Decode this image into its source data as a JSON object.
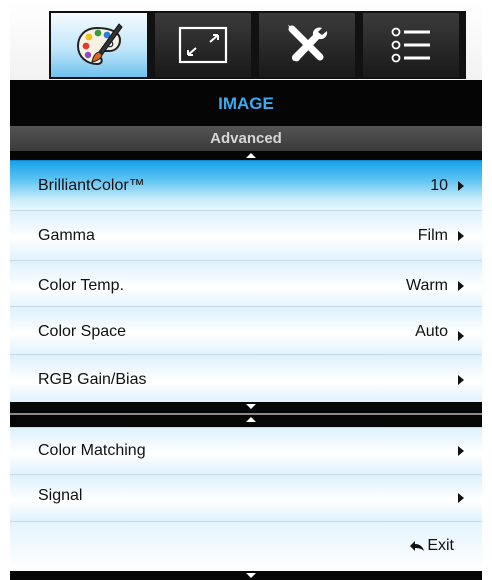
{
  "tabs": [
    {
      "icon": "palette-icon",
      "active": true
    },
    {
      "icon": "screen-resize-icon",
      "active": false
    },
    {
      "icon": "wrench-screwdriver-icon",
      "active": false
    },
    {
      "icon": "options-list-icon",
      "active": false
    }
  ],
  "header": {
    "title": "IMAGE",
    "subtitle": "Advanced"
  },
  "page1_items": [
    {
      "label": "BrilliantColor™",
      "value": "10",
      "selected": true
    },
    {
      "label": "Gamma",
      "value": "Film",
      "selected": false
    },
    {
      "label": "Color Temp.",
      "value": "Warm",
      "selected": false
    },
    {
      "label": "Color Space",
      "value": "Auto",
      "selected": false
    },
    {
      "label": "RGB Gain/Bias",
      "value": "",
      "selected": false
    }
  ],
  "page2_items": [
    {
      "label": "Color Matching",
      "value": ""
    },
    {
      "label": "Signal",
      "value": ""
    }
  ],
  "exit_label": "Exit",
  "colors": {
    "accent_title": "#3daaf0",
    "selected_row": "#17a2e9",
    "row_background": "#ddf1fc",
    "frame": "#050505"
  }
}
